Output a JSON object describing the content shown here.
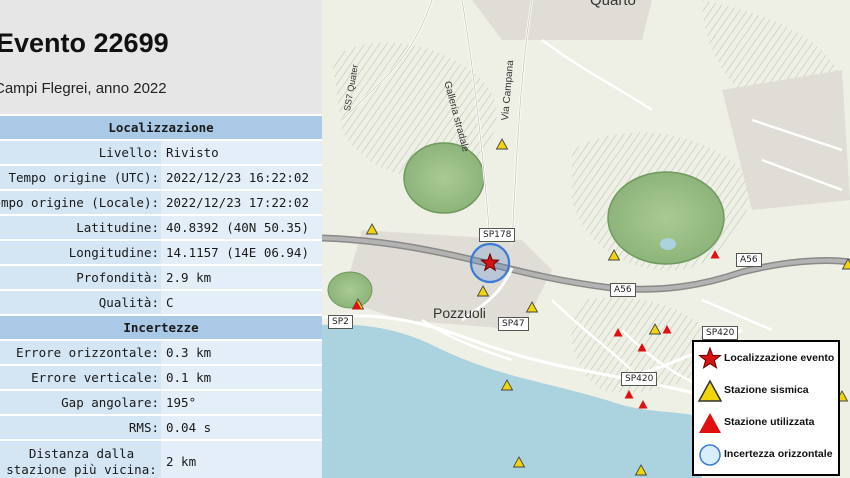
{
  "panel": {
    "title": "Evento 22699",
    "subtitle": "Campi Flegrei, anno 2022",
    "sections": [
      {
        "header": "Localizzazione",
        "rows": [
          {
            "key": "Livello:",
            "value": "Rivisto"
          },
          {
            "key": "Tempo origine (UTC):",
            "value": "2022/12/23 16:22:02"
          },
          {
            "key": "Tempo origine (Locale):",
            "value": "2022/12/23 17:22:02"
          },
          {
            "key": "Latitudine:",
            "value": "40.8392 (40N 50.35)"
          },
          {
            "key": "Longitudine:",
            "value": "14.1157 (14E 06.94)"
          },
          {
            "key": "Profondità:",
            "value": "2.9 km"
          },
          {
            "key": "Qualità:",
            "value": "C"
          }
        ]
      },
      {
        "header": "Incertezze",
        "rows": [
          {
            "key": "Errore orizzontale:",
            "value": "0.3 km"
          },
          {
            "key": "Errore verticale:",
            "value": "0.1 km"
          },
          {
            "key": "Gap angolare:",
            "value": "195°"
          },
          {
            "key": "RMS:",
            "value": "0.04 s"
          },
          {
            "key": "Distanza dalla stazione più vicina:",
            "value": "2 km"
          }
        ]
      }
    ]
  },
  "map": {
    "place_labels": {
      "quarto": "Quarto",
      "pozzuoli": "Pozzuoli",
      "galleria": "Galleria stradale",
      "via_campana": "Via Campana",
      "ss7": "SS7 Quater"
    },
    "road_shields": {
      "sp178": "SP178",
      "a56_right": "A56",
      "a56_mid": "A56",
      "sp2": "SP2",
      "sp47": "SP47",
      "sp420_top": "SP420",
      "sp420_bottom": "SP420"
    },
    "colors": {
      "land": "#eef0e6",
      "sea": "#aad3df",
      "crater": "#99bf84",
      "epicenter": "#d41414",
      "station_sismica": "#f2d40a",
      "station_utilizzata": "#e01010",
      "uncertainty": "#3a7bd5"
    }
  },
  "legend": {
    "epicenter": "Localizzazione evento",
    "station_sismica": "Stazione sismica",
    "station_utilizzata": "Stazione utilizzata",
    "uncertainty": "Incertezza orizzontale"
  }
}
